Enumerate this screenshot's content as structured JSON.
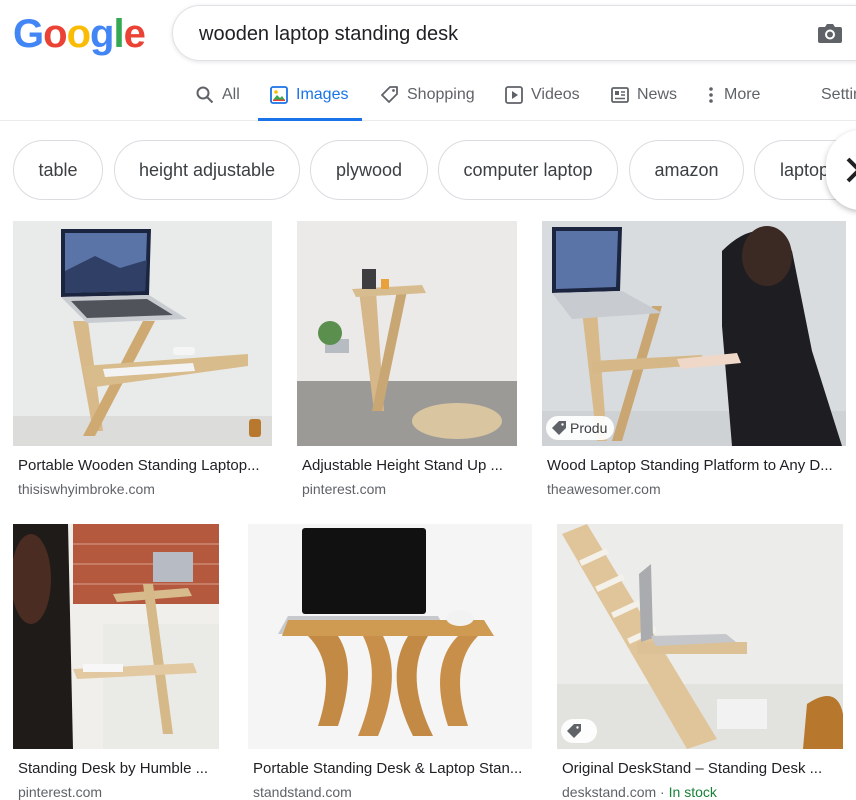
{
  "logo": {
    "letters": [
      "G",
      "o",
      "o",
      "g",
      "l",
      "e"
    ],
    "colors": [
      "#4285f4",
      "#ea4335",
      "#fbbc05",
      "#4285f4",
      "#34a853",
      "#ea4335"
    ]
  },
  "search": {
    "query": "wooden laptop standing desk"
  },
  "tabs": [
    {
      "label": "All",
      "icon": "search-icon"
    },
    {
      "label": "Images",
      "icon": "image-icon"
    },
    {
      "label": "Shopping",
      "icon": "tag-icon"
    },
    {
      "label": "Videos",
      "icon": "play-icon"
    },
    {
      "label": "News",
      "icon": "newspaper-icon"
    },
    {
      "label": "More",
      "icon": "more-vert-icon"
    },
    {
      "label": "Settings"
    }
  ],
  "chips": [
    "table",
    "height adjustable",
    "plywood",
    "computer laptop",
    "amazon",
    "laptop"
  ],
  "results": [
    {
      "title": "Portable Wooden Standing Laptop...",
      "domain": "thisiswhyimbroke.com"
    },
    {
      "title": "Adjustable Height Stand Up ...",
      "domain": "pinterest.com"
    },
    {
      "title": "Wood Laptop Standing Platform to Any D...",
      "domain": "theawesomer.com",
      "badge": "Produ"
    },
    {
      "title": "Standing Desk by Humble ...",
      "domain": "pinterest.com"
    },
    {
      "title": "Portable Standing Desk & Laptop Stan...",
      "domain": "standstand.com"
    },
    {
      "title": "Original DeskStand – Standing Desk ...",
      "domain": "deskstand.com",
      "stock_sep": " · ",
      "stock": "In stock"
    }
  ],
  "colors": {
    "accent": "#1a73e8",
    "stock": "#188038"
  }
}
